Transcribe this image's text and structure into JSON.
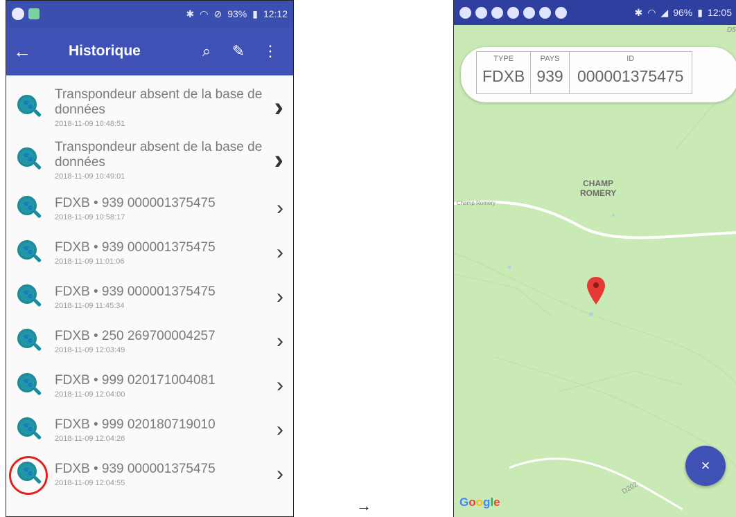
{
  "left": {
    "status": {
      "battery": "93%",
      "time": "12:12"
    },
    "appbar": {
      "title": "Historique"
    },
    "rows": [
      {
        "main": "Transpondeur absent de la base de données",
        "date": "2018-11-09 10:48:51"
      },
      {
        "main": "Transpondeur absent de la base de données",
        "date": "2018-11-09 10:49:01"
      },
      {
        "main": "FDXB • 939 000001375475",
        "date": "2018-11-09 10:58:17"
      },
      {
        "main": "FDXB • 939 000001375475",
        "date": "2018-11-09 11:01:06"
      },
      {
        "main": "FDXB • 939 000001375475",
        "date": "2018-11-09 11:45:34"
      },
      {
        "main": "FDXB • 250 269700004257",
        "date": "2018-11-09 12:03:49"
      },
      {
        "main": "FDXB • 999 020171004081",
        "date": "2018-11-09 12:04:00"
      },
      {
        "main": "FDXB • 999 020180719010",
        "date": "2018-11-09 12:04:26"
      },
      {
        "main": "FDXB • 939 000001375475",
        "date": "2018-11-09 12:04:55"
      }
    ]
  },
  "arrow": "→",
  "right": {
    "status": {
      "battery": "96%",
      "time": "12:05"
    },
    "card": {
      "type_header": "TYPE",
      "type_value": "FDXB",
      "pays_header": "PAYS",
      "pays_value": "939",
      "id_header": "ID",
      "id_value": "000001375475"
    },
    "map_labels": {
      "champ": "CHAMP\nROMERY",
      "champ_small": "Champ Romery",
      "road": "D202",
      "corner": "D5"
    },
    "google": "Google",
    "fab_icon": "×"
  },
  "colors": {
    "appbar": "#3f51b5",
    "map": "#c9e9b5",
    "pin": "#e53935",
    "ring": "#e0231c"
  }
}
